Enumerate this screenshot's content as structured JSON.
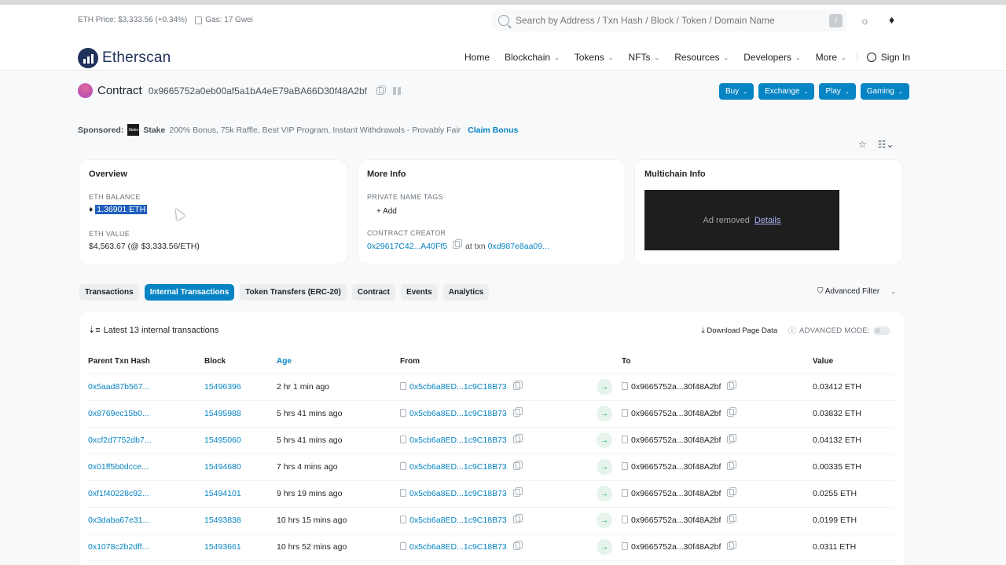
{
  "header": {
    "eth_price": "ETH Price: $3,333.56 (+0.34%)",
    "gas": "Gas: 17 Gwei",
    "search_placeholder": "Search by Address / Txn Hash / Block / Token / Domain Name",
    "search_shortcut": "/",
    "logo_text": "Etherscan",
    "nav": [
      {
        "label": "Home",
        "dropdown": false
      },
      {
        "label": "Blockchain",
        "dropdown": true
      },
      {
        "label": "Tokens",
        "dropdown": true
      },
      {
        "label": "NFTs",
        "dropdown": true
      },
      {
        "label": "Resources",
        "dropdown": true
      },
      {
        "label": "Developers",
        "dropdown": true
      },
      {
        "label": "More",
        "dropdown": true
      }
    ],
    "sign_in": "Sign In"
  },
  "contract": {
    "label": "Contract",
    "address": "0x9665752a0eb00af5a1bA4eE79aBA66D30f48A2bf"
  },
  "action_buttons": [
    "Buy",
    "Exchange",
    "Play",
    "Gaming"
  ],
  "sponsored": {
    "label": "Sponsored:",
    "brand": "Stake",
    "text": "200% Bonus, 75k Raffle, Best VIP Program, Instant Withdrawals - Provably Fair",
    "cta": "Claim Bonus",
    "logo_text": "Stake"
  },
  "overview": {
    "title": "Overview",
    "balance_label": "ETH BALANCE",
    "balance": "1.36901 ETH",
    "value_label": "ETH VALUE",
    "value": "$4,563.67 (@ $3,333.56/ETH)"
  },
  "more_info": {
    "title": "More Info",
    "tags_label": "PRIVATE NAME TAGS",
    "add_label": "+ Add",
    "creator_label": "CONTRACT CREATOR",
    "creator": "0x29617C42...A40Ff5",
    "at_txn": "at txn",
    "txn": "0xd987e8aa09..."
  },
  "multichain": {
    "title": "Multichain Info",
    "ad_text": "Ad removed",
    "ad_link": "Details"
  },
  "tabs": [
    {
      "label": "Transactions",
      "active": false
    },
    {
      "label": "Internal Transactions",
      "active": true
    },
    {
      "label": "Token Transfers (ERC-20)",
      "active": false
    },
    {
      "label": "Contract",
      "active": false
    },
    {
      "label": "Events",
      "active": false
    },
    {
      "label": "Analytics",
      "active": false
    }
  ],
  "advanced_filter": "Advanced Filter",
  "table": {
    "summary": "Latest 13 internal transactions",
    "download": "Download Page Data",
    "advanced_mode": "ADVANCED MODE:",
    "columns": [
      "Parent Txn Hash",
      "Block",
      "Age",
      "From",
      "",
      "To",
      "Value"
    ],
    "rows": [
      {
        "hash": "0x5aad87b567...",
        "block": "15496396",
        "age": "2 hr 1 min ago",
        "from": "0x5cb6a8ED...1c9C18B73",
        "to": "0x9665752a...30f48A2bf",
        "value": "0.03412 ETH"
      },
      {
        "hash": "0x8769ec15b0...",
        "block": "15495988",
        "age": "5 hrs 41 mins ago",
        "from": "0x5cb6a8ED...1c9C18B73",
        "to": "0x9665752a...30f48A2bf",
        "value": "0.03832 ETH"
      },
      {
        "hash": "0xcf2d7752db7...",
        "block": "15495060",
        "age": "5 hrs 41 mins ago",
        "from": "0x5cb6a8ED...1c9C18B73",
        "to": "0x9665752a...30f48A2bf",
        "value": "0.04132 ETH"
      },
      {
        "hash": "0x01ff5b0dcce...",
        "block": "15494680",
        "age": "7 hrs 4 mins ago",
        "from": "0x5cb6a8ED...1c9C18B73",
        "to": "0x9665752a...30f48A2bf",
        "value": "0.00335 ETH"
      },
      {
        "hash": "0xf1f40228c92...",
        "block": "15494101",
        "age": "9 hrs 19 mins ago",
        "from": "0x5cb6a8ED...1c9C18B73",
        "to": "0x9665752a...30f48A2bf",
        "value": "0.0255 ETH"
      },
      {
        "hash": "0x3daba67e31...",
        "block": "15493838",
        "age": "10 hrs 15 mins ago",
        "from": "0x5cb6a8ED...1c9C18B73",
        "to": "0x9665752a...30f48A2bf",
        "value": "0.0199 ETH"
      },
      {
        "hash": "0x1078c2b2dff...",
        "block": "15493661",
        "age": "10 hrs 52 mins ago",
        "from": "0x5cb6a8ED...1c9C18B73",
        "to": "0x9665752a...30f48A2bf",
        "value": "0.0311 ETH"
      }
    ]
  },
  "colors": {
    "accent": "#0784c3",
    "logo": "#21325b",
    "arrow_bg": "#e6f4ec",
    "arrow_fg": "#00a186"
  }
}
